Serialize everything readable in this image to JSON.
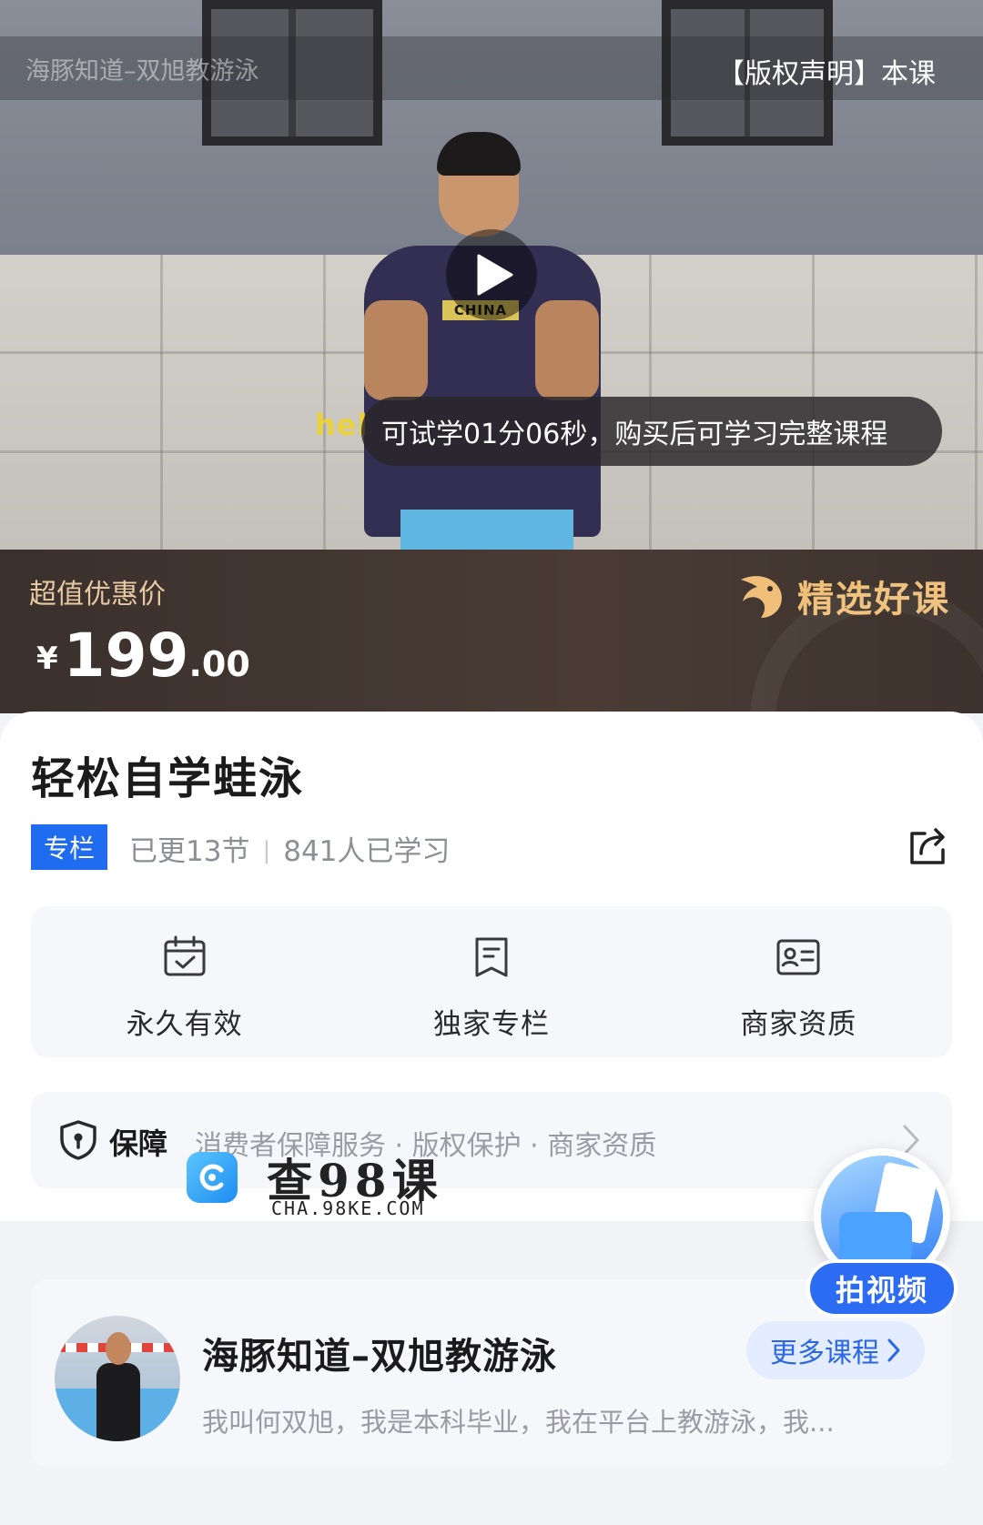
{
  "video": {
    "watermark_title": "海豚知道–双旭教游泳",
    "copyright_notice": "【版权声明】本课",
    "shirt_text": "CHINA",
    "subtitle_fragment": "hel",
    "trial_notice": "可试学01分06秒，购买后可学习完整课程"
  },
  "price": {
    "label": "超值优惠价",
    "currency": "¥",
    "integer": "199",
    "decimal": ".00",
    "badge": "精选好课"
  },
  "course": {
    "title": "轻松自学蛙泳",
    "tag": "专栏",
    "updated": "已更13节",
    "learners": "841人已学习"
  },
  "features": [
    {
      "icon": "calendar-check-icon",
      "label": "永久有效"
    },
    {
      "icon": "bookmark-doc-icon",
      "label": "独家专栏"
    },
    {
      "icon": "id-card-icon",
      "label": "商家资质"
    }
  ],
  "guarantee": {
    "title": "保障",
    "items": "消费者保障服务 · 版权保护 · 商家资质"
  },
  "site_watermark": {
    "name": "查98课",
    "url": "CHA.98KE.COM"
  },
  "float_button": {
    "label": "拍视频"
  },
  "teacher": {
    "name": "海豚知道–双旭教游泳",
    "more_label": "更多课程",
    "description": "我叫何双旭，我是本科毕业，我在平台上教游泳，我..."
  },
  "colors": {
    "accent_blue": "#1f6cf0",
    "gold": "#f0c07a",
    "price_bg": "#3a302c"
  }
}
